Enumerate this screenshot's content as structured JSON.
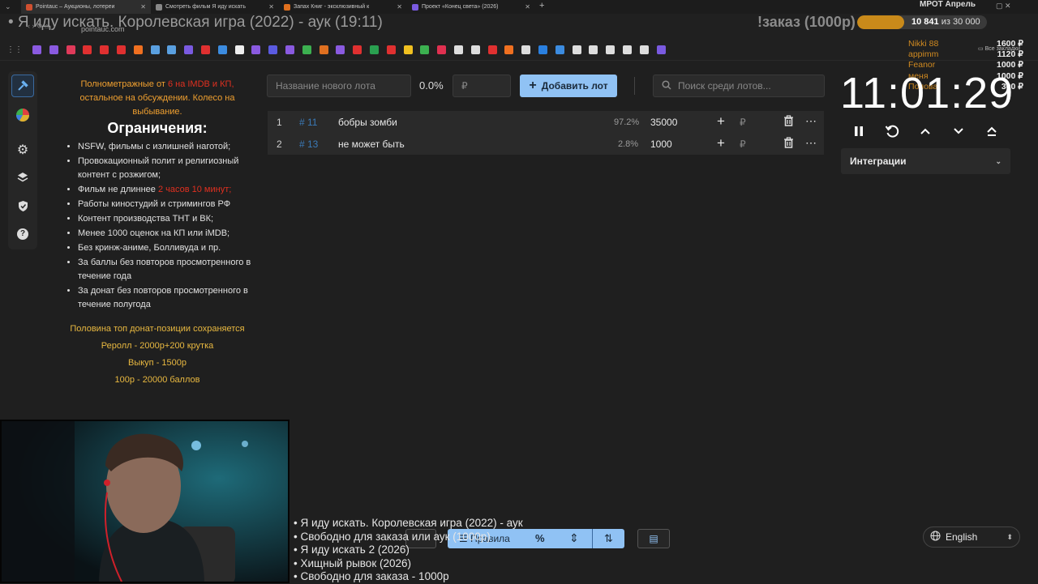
{
  "browser": {
    "tabs": [
      {
        "title": "Pointauc – Аукционы, лотереи",
        "color": "#d05030",
        "active": true
      },
      {
        "title": "Смотреть фильм Я иду искать",
        "color": "#888888"
      },
      {
        "title": "Запах Книг - эксклюзивный к",
        "color": "#e0701e"
      },
      {
        "title": "Проект «Конец света» (2026)",
        "color": "#7a5ae0"
      }
    ],
    "url": "pointauc.com",
    "all_bookmarks": "Все закладки"
  },
  "overlay": {
    "stream_title": "• Я иду искать. Королевская игра (2022) - аук (19:11)",
    "order_label": "!заказ (1000р)",
    "mrot_label": "МРОТ Апрель",
    "progress_current": "10 841",
    "progress_of": "из 30 000",
    "progress_fraction": 0.3614,
    "donors": [
      "Nikki 88",
      "appimm",
      "Feanor",
      "меня",
      "Попова"
    ],
    "donor_amounts": [
      "1600 ₽",
      "1120 ₽",
      "1000 ₽",
      "1000 ₽",
      "300 ₽"
    ]
  },
  "rules": {
    "intro_1": "Полнометражные от ",
    "intro_red": "6 на IMDB и КП,",
    "intro_2": "остальное на обсуждении. Колесо на выбывание.",
    "heading": "Ограничения:",
    "items": [
      "NSFW, фильмы с излишней наготой;",
      "Провокационный полит и религиозный контент с розжигом;",
      "Фильм не длиннее ",
      "Работы киностудий и стримингов РФ",
      "Контент производства ТНТ и ВК;",
      "Менее 1000 оценок на КП или iMDB;",
      "Без кринж-аниме, Болливуда и пр.",
      "За баллы без повторов просмотренного в течение года",
      "За донат без повторов просмотренного в течение полугода"
    ],
    "duration_red": "2 часов 10 минут;",
    "footer": [
      "Половина топ донат-позиции сохраняется",
      "Реролл - 2000р+200 крутка",
      "Выкуп - 1500р",
      "100р - 20000 баллов"
    ]
  },
  "controls": {
    "new_lot_placeholder": "Название нового лота",
    "percent": "0.0%",
    "currency": "₽",
    "add_button": "Добавить лот",
    "search_placeholder": "Поиск среди лотов..."
  },
  "lots": [
    {
      "index": "1",
      "id": "# 11",
      "name": "бобры зомби",
      "percent": "97.2%",
      "amount": "35000",
      "currency": "₽"
    },
    {
      "index": "2",
      "id": "# 13",
      "name": "не может быть",
      "percent": "2.8%",
      "amount": "1000",
      "currency": "₽"
    }
  ],
  "timer": {
    "time": "11:01:29"
  },
  "integrations_label": "Интеграции",
  "subtitles": [
    "• Я иду искать. Королевская игра (2022) - аук",
    "• Свободно для заказа или аук (1000р)",
    "• Я иду искать 2 (2026)",
    "• Хищный рывок (2026)",
    "• Свободно для заказа - 1000р"
  ],
  "bottom_bar": {
    "rules_label": "Правила"
  },
  "language": "English",
  "colors": {
    "accent": "#90c2f4",
    "orange": "#f0a030",
    "red": "#e03020",
    "progress": "#c98a1a"
  }
}
